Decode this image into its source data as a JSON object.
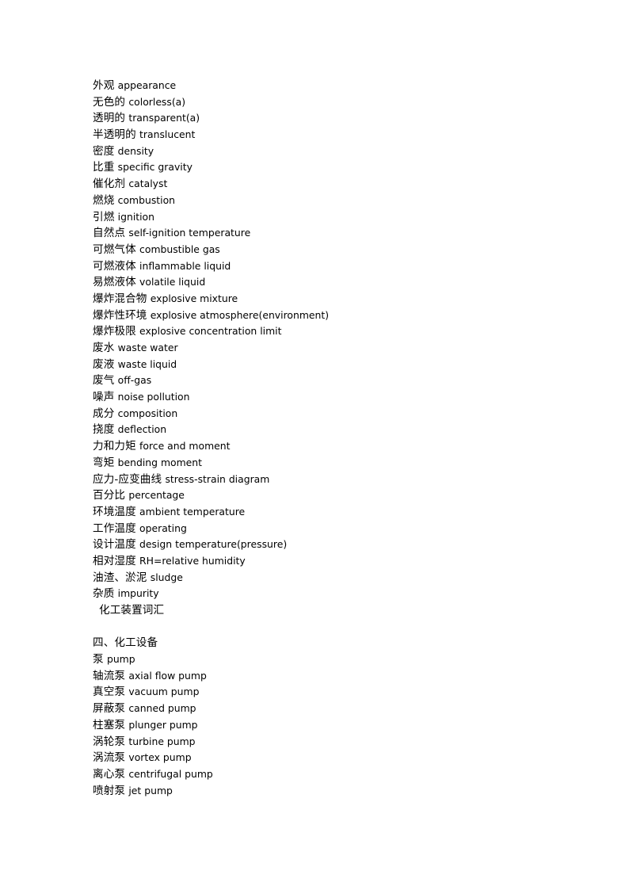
{
  "document": {
    "title": "化工装置词汇",
    "background_color": "#ffffff",
    "text_color": "#000000",
    "lines": [
      {
        "cn": "外观",
        "en": "appearance",
        "type": "entry"
      },
      {
        "cn": "无色的",
        "en": "colorless(a)",
        "type": "entry"
      },
      {
        "cn": "透明的",
        "en": "transparent(a)",
        "type": "entry"
      },
      {
        "cn": "半透明的",
        "en": "translucent",
        "type": "entry"
      },
      {
        "cn": "密度",
        "en": "density",
        "type": "entry"
      },
      {
        "cn": "比重",
        "en": "specific gravity",
        "type": "entry"
      },
      {
        "cn": "催化剂",
        "en": "catalyst",
        "type": "entry"
      },
      {
        "cn": "燃烧",
        "en": "combustion",
        "type": "entry"
      },
      {
        "cn": "引燃",
        "en": "ignition",
        "type": "entry"
      },
      {
        "cn": "自然点",
        "en": "self-ignition temperature",
        "type": "entry"
      },
      {
        "cn": "可燃气体",
        "en": "combustible gas",
        "type": "entry"
      },
      {
        "cn": "可燃液体",
        "en": "inflammable liquid",
        "type": "entry"
      },
      {
        "cn": "易燃液体",
        "en": "volatile liquid",
        "type": "entry"
      },
      {
        "cn": "爆炸混合物",
        "en": "explosive mixture",
        "type": "entry"
      },
      {
        "cn": "爆炸性环境",
        "en": "explosive atmosphere(environment)",
        "type": "entry"
      },
      {
        "cn": "爆炸极限",
        "en": "explosive concentration limit",
        "type": "entry"
      },
      {
        "cn": "废水",
        "en": "waste water",
        "type": "entry"
      },
      {
        "cn": "废液",
        "en": "waste liquid",
        "type": "entry"
      },
      {
        "cn": "废气",
        "en": "off-gas",
        "type": "entry"
      },
      {
        "cn": "噪声",
        "en": "noise pollution",
        "type": "entry"
      },
      {
        "cn": "成分",
        "en": "composition",
        "type": "entry"
      },
      {
        "cn": "挠度",
        "en": "deflection",
        "type": "entry"
      },
      {
        "cn": "力和力矩",
        "en": "force and moment",
        "type": "entry"
      },
      {
        "cn": "弯矩",
        "en": "bending moment",
        "type": "entry"
      },
      {
        "cn": "应力-应变曲线",
        "en": "stress-strain diagram",
        "type": "entry"
      },
      {
        "cn": "百分比",
        "en": "percentage",
        "type": "entry"
      },
      {
        "cn": "环境温度",
        "en": "ambient temperature",
        "type": "entry"
      },
      {
        "cn": "工作温度",
        "en": "operating",
        "type": "entry"
      },
      {
        "cn": "设计温度",
        "en": "design temperature(pressure)",
        "type": "entry"
      },
      {
        "cn": "相对湿度",
        "en": "RH=relative humidity",
        "type": "entry"
      },
      {
        "cn": "油渣、淤泥",
        "en": "sludge",
        "type": "entry"
      },
      {
        "cn": "杂质",
        "en": "impurity",
        "type": "entry"
      },
      {
        "cn": "化工装置词汇",
        "en": "",
        "type": "indented-title"
      },
      {
        "cn": "",
        "en": "",
        "type": "blank"
      },
      {
        "cn": "四、化工设备",
        "en": "",
        "type": "heading"
      },
      {
        "cn": "泵",
        "en": "pump",
        "type": "entry"
      },
      {
        "cn": "轴流泵",
        "en": "axial flow pump",
        "type": "entry"
      },
      {
        "cn": "真空泵",
        "en": "vacuum pump",
        "type": "entry"
      },
      {
        "cn": "屏蔽泵",
        "en": "canned pump",
        "type": "entry"
      },
      {
        "cn": "柱塞泵",
        "en": "plunger pump",
        "type": "entry"
      },
      {
        "cn": "涡轮泵",
        "en": "turbine pump",
        "type": "entry"
      },
      {
        "cn": "涡流泵",
        "en": "vortex pump",
        "type": "entry"
      },
      {
        "cn": "离心泵",
        "en": "centrifugal pump",
        "type": "entry"
      },
      {
        "cn": "喷射泵",
        "en": "jet pump",
        "type": "entry"
      }
    ]
  }
}
